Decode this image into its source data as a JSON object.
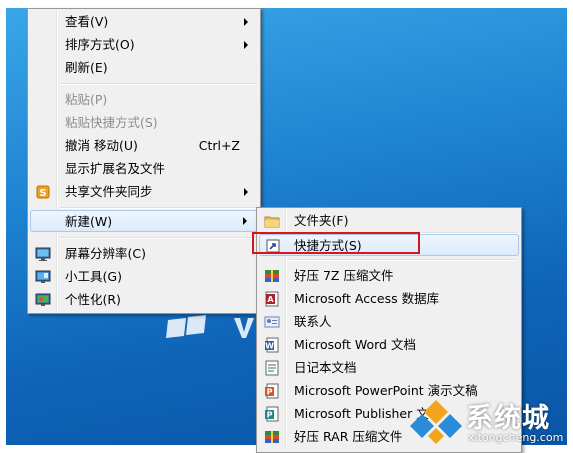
{
  "context_menu": {
    "items": [
      {
        "label": "查看(V)"
      },
      {
        "label": "排序方式(O)"
      },
      {
        "label": "刷新(E)"
      },
      {
        "label": "粘贴(P)"
      },
      {
        "label": "粘贴快捷方式(S)"
      },
      {
        "label": "撤消 移动(U)",
        "shortcut": "Ctrl+Z"
      },
      {
        "label": "显示扩展名及文件"
      },
      {
        "label": "共享文件夹同步",
        "icon": "sync-s-icon"
      },
      {
        "label": "新建(W)"
      },
      {
        "label": "屏幕分辨率(C)",
        "icon": "monitor-icon"
      },
      {
        "label": "小工具(G)",
        "icon": "gadgets-icon"
      },
      {
        "label": "个性化(R)",
        "icon": "personalize-icon"
      }
    ]
  },
  "new_submenu": {
    "items": [
      {
        "label": "文件夹(F)",
        "icon": "folder-icon"
      },
      {
        "label": "快捷方式(S)",
        "icon": "shortcut-icon"
      },
      {
        "label": "好压 7Z 压缩文件",
        "icon": "archive-icon"
      },
      {
        "label": "Microsoft Access 数据库",
        "icon": "access-icon"
      },
      {
        "label": "联系人",
        "icon": "contact-icon"
      },
      {
        "label": "Microsoft Word 文档",
        "icon": "word-icon"
      },
      {
        "label": "日记本文档",
        "icon": "journal-icon"
      },
      {
        "label": "Microsoft PowerPoint 演示文稿",
        "icon": "powerpoint-icon"
      },
      {
        "label": "Microsoft Publisher 文档",
        "icon": "publisher-icon"
      },
      {
        "label": "好压 RAR 压缩文件",
        "icon": "archive-icon"
      }
    ]
  },
  "watermark": {
    "title": "系统城",
    "url": "xitongcheng.com"
  },
  "colors": {
    "desktop": "#1f86d3",
    "highlight_box": "#d9141b",
    "menu_bg": "#f0f0f0"
  }
}
